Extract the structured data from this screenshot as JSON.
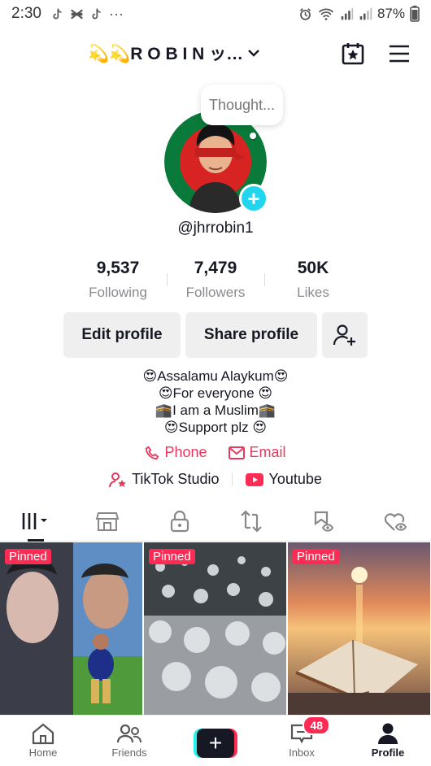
{
  "status_bar": {
    "time": "2:30",
    "overflow": "···",
    "battery_percent": "87%",
    "icons": [
      "tiktok-icon",
      "capcut-icon",
      "tiktok-icon",
      "alarm-icon",
      "wifi-icon",
      "signal-icon",
      "signal-icon",
      "battery-icon"
    ]
  },
  "header": {
    "title": "💫💫R O B I N ッ…",
    "icons": [
      "chevron-down-icon",
      "calendar-star-icon",
      "menu-icon"
    ]
  },
  "profile": {
    "thought_placeholder": "Thought...",
    "handle": "@jhrrobin1",
    "add_icon": "plus-icon"
  },
  "stats": [
    {
      "value": "9,537",
      "label": "Following"
    },
    {
      "value": "7,479",
      "label": "Followers"
    },
    {
      "value": "50K",
      "label": "Likes"
    }
  ],
  "actions": {
    "edit_profile": "Edit profile",
    "share_profile": "Share profile",
    "add_friend_icon": "add-friend-icon"
  },
  "bio": [
    "😍Assalamu Alaykum😍",
    "😍For everyone 😍",
    "🕋I am a Muslim🕋",
    "😍Support plz 😍"
  ],
  "links": {
    "phone": "Phone",
    "email": "Email",
    "studio": "TikTok Studio",
    "youtube": "Youtube"
  },
  "tabs": [
    "videos-grid-icon",
    "shop-icon",
    "lock-icon",
    "repost-icon",
    "favorites-icon",
    "liked-icon"
  ],
  "videos": [
    {
      "badge": "Pinned"
    },
    {
      "badge": "Pinned"
    },
    {
      "badge": "Pinned"
    }
  ],
  "bottom_nav": {
    "home": "Home",
    "friends": "Friends",
    "inbox": "Inbox",
    "inbox_badge": "48",
    "profile": "Profile"
  },
  "colors": {
    "accent": "#fe2c55",
    "link": "#e6395e",
    "cyan": "#20d5ec"
  }
}
